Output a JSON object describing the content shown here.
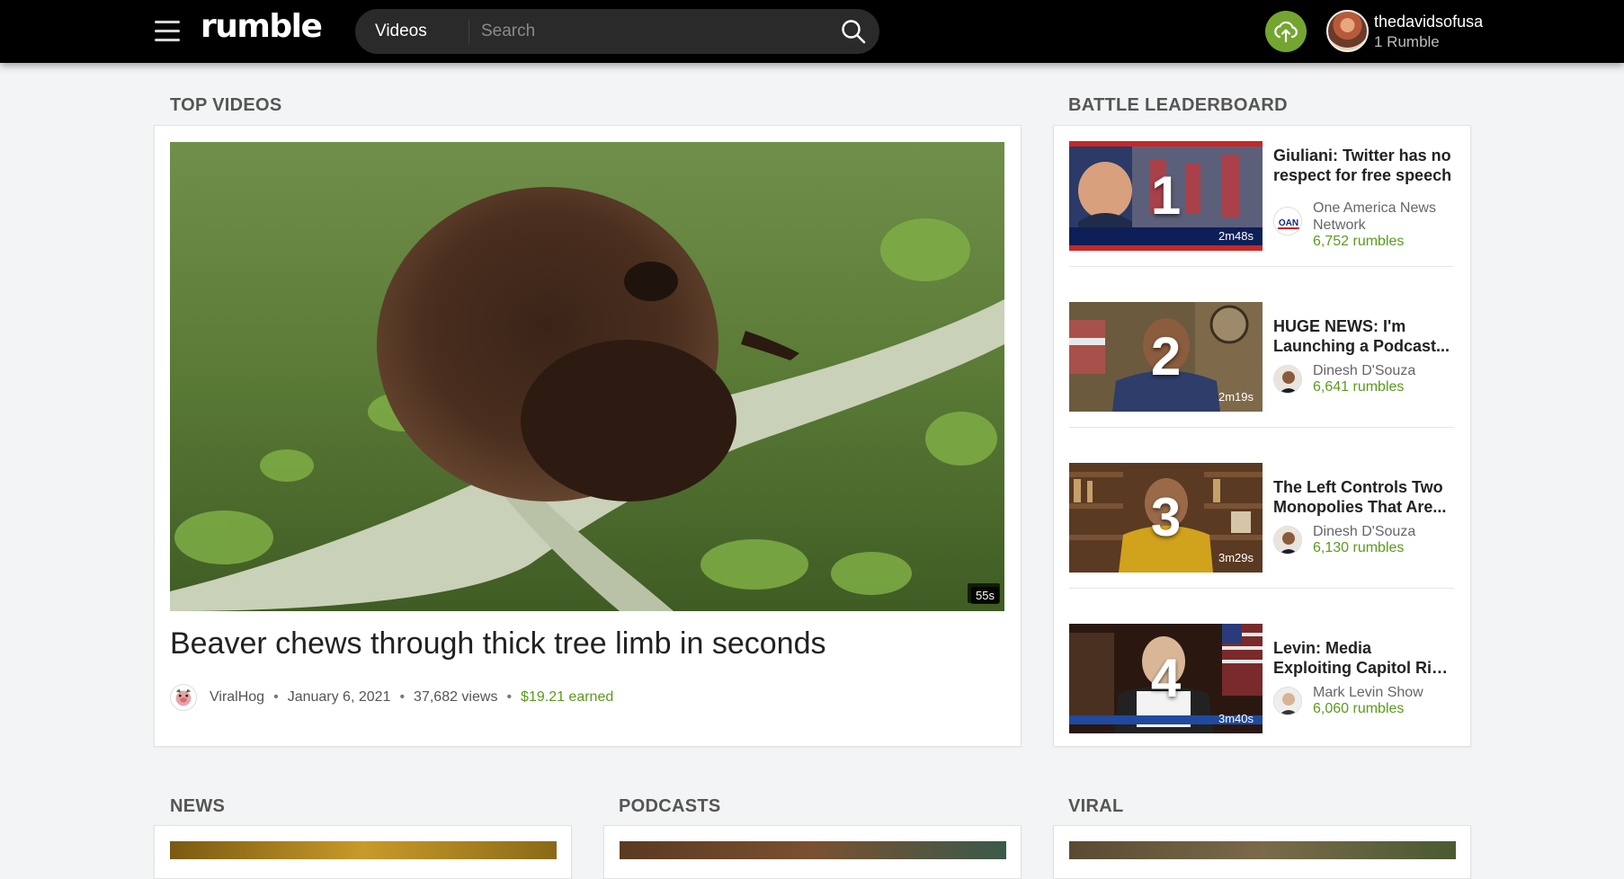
{
  "header": {
    "logo_text": "rumble",
    "search_scope": "Videos",
    "search_placeholder": "Search",
    "user": {
      "name": "thedavidsofusa",
      "subtitle": "1 Rumble"
    },
    "icons": [
      "menu-icon",
      "search-icon",
      "upload-icon"
    ],
    "accent_color": "#74a531"
  },
  "top_videos": {
    "heading": "TOP VIDEOS",
    "featured": {
      "title": "Beaver chews through thick tree limb in seconds",
      "duration": "55s",
      "channel": "ViralHog",
      "date": "January 6, 2021",
      "views": "37,682 views",
      "earned": "$19.21 earned"
    }
  },
  "leaderboard": {
    "heading": "BATTLE LEADERBOARD",
    "items": [
      {
        "rank": "1",
        "title": "Giuliani: Twitter has no respect for free speech",
        "channel": "One America News Network",
        "rumbles": "6,752 rumbles",
        "duration": "2m48s"
      },
      {
        "rank": "2",
        "title": "HUGE NEWS: I'm Launching a Podcast...",
        "channel": "Dinesh D'Souza",
        "rumbles": "6,641 rumbles",
        "duration": "2m19s"
      },
      {
        "rank": "3",
        "title": "The Left Controls Two Monopolies That Are...",
        "channel": "Dinesh D'Souza",
        "rumbles": "6,130 rumbles",
        "duration": "3m29s"
      },
      {
        "rank": "4",
        "title": "Levin: Media Exploiting Capitol Riot to Silenc...",
        "channel": "Mark Levin Show",
        "rumbles": "6,060 rumbles",
        "duration": "3m40s"
      }
    ]
  },
  "sections": {
    "news": "NEWS",
    "podcasts": "PODCASTS",
    "viral": "VIRAL"
  }
}
